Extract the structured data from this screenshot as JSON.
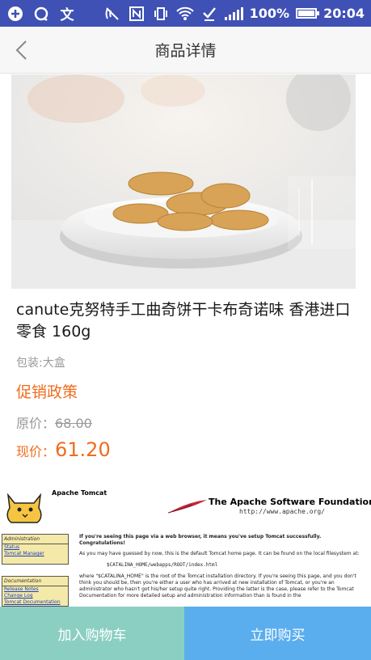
{
  "status_bar": {
    "battery_percent": "100%",
    "time": "20:04",
    "battery_level": 1.0,
    "icons": [
      "add-box-icon",
      "data-sync-icon",
      "translate-icon",
      "nfc-off-icon",
      "n-icon",
      "vibrate-icon",
      "wifi-icon",
      "check-icon",
      "signal-icon",
      "battery-icon"
    ]
  },
  "nav": {
    "title": "商品详情",
    "back_icon": "chevron-left-icon"
  },
  "product": {
    "title": "canute克努特手工曲奇饼干卡布奇诺味 香港进口零食 160g",
    "packaging": "包装:大盒",
    "promo_label": "促销政策",
    "original_price_label": "原价：",
    "original_price": "68.00",
    "current_price_label": "现价：",
    "current_price": "61.20"
  },
  "embedded_page": {
    "tomcat_name": "Apache Tomcat",
    "asf_title": "The Apache Software Foundation",
    "asf_url": "http://www.apache.org/",
    "admin_heading": "Administration",
    "admin_links": [
      "Status",
      "Tomcat Manager"
    ],
    "doc_heading": "Documentation",
    "doc_links": [
      "Release Notes",
      "Change Log",
      "Tomcat Documentation"
    ],
    "lead": "If you're seeing this page via a web browser, it means you've setup Tomcat successfully. Congratulations!",
    "para1": "As you may have guessed by now, this is the default Tomcat home page. It can be found on the local filesystem at:",
    "code": "$CATALINA_HOME/webapps/ROOT/index.html",
    "para2": "where \"$CATALINA_HOME\" is the root of the Tomcat installation directory. If you're seeing this page, and you don't think you should be, then you're either a user who has arrived at new installation of Tomcat, or you're an administrator who hasn't got his/her setup quite right. Providing the latter is the case, please refer to the Tomcat Documentation for more detailed setup and administration information than is found in the"
  },
  "actions": {
    "add_to_cart": "加入购物车",
    "buy_now": "立即购买"
  },
  "colors": {
    "status_bar": "#3f51b5",
    "accent_orange": "#f06c1e",
    "cart_button": "#8bcfc3",
    "buy_button": "#5aaeee"
  }
}
